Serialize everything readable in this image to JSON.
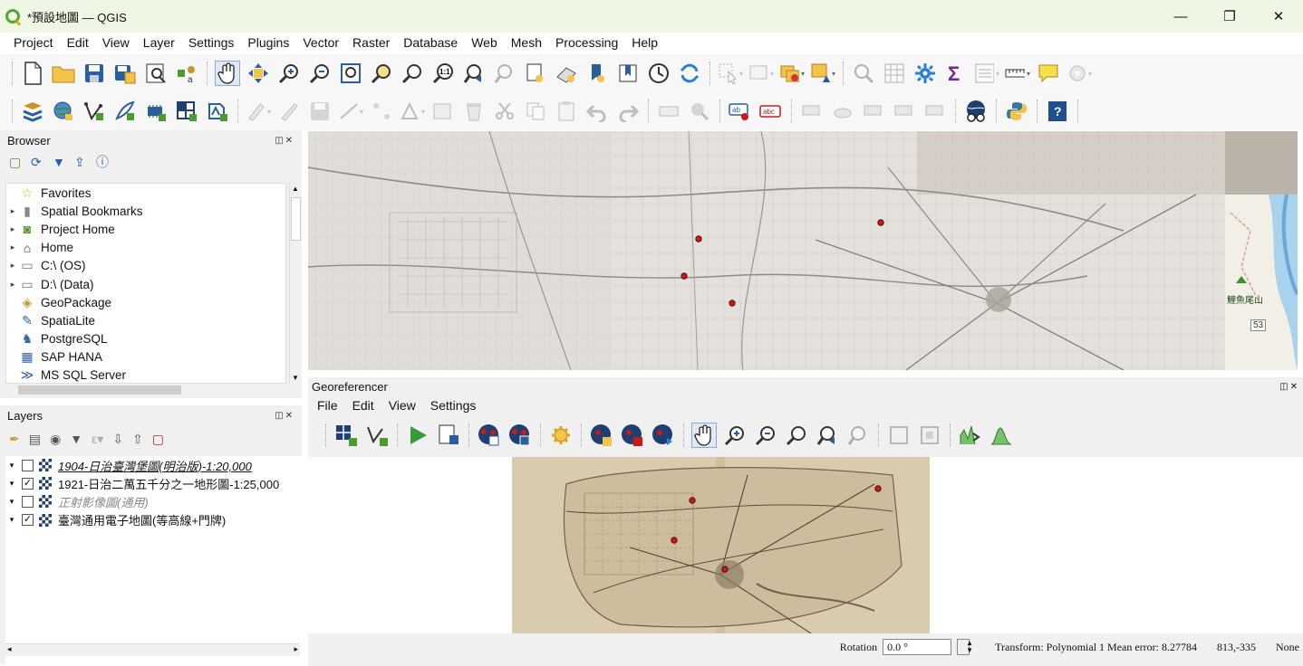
{
  "window": {
    "title": "*預設地圖 — QGIS",
    "controls": {
      "minimize": "—",
      "maximize": "❐",
      "close": "✕"
    }
  },
  "menubar": [
    "Project",
    "Edit",
    "View",
    "Layer",
    "Settings",
    "Plugins",
    "Vector",
    "Raster",
    "Database",
    "Web",
    "Mesh",
    "Processing",
    "Help"
  ],
  "browser": {
    "title": "Browser",
    "items": [
      {
        "label": "Favorites",
        "icon": "star-icon",
        "glyph": "☆",
        "color": "#e3b100",
        "arrow": ""
      },
      {
        "label": "Spatial Bookmarks",
        "icon": "bookmark-icon",
        "glyph": "▮",
        "color": "#888888",
        "arrow": "▸"
      },
      {
        "label": "Project Home",
        "icon": "project-home-icon",
        "glyph": "◙",
        "color": "#4b9b2f",
        "arrow": "▸"
      },
      {
        "label": "Home",
        "icon": "home-icon",
        "glyph": "⌂",
        "color": "#333333",
        "arrow": "▸"
      },
      {
        "label": "C:\\ (OS)",
        "icon": "folder-icon",
        "glyph": "▭",
        "color": "#777777",
        "arrow": "▸"
      },
      {
        "label": "D:\\ (Data)",
        "icon": "folder-icon",
        "glyph": "▭",
        "color": "#777777",
        "arrow": "▸"
      },
      {
        "label": "GeoPackage",
        "icon": "geopackage-icon",
        "glyph": "◈",
        "color": "#c6962a",
        "arrow": ""
      },
      {
        "label": "SpatiaLite",
        "icon": "spatialite-icon",
        "glyph": "✎",
        "color": "#2a5f9e",
        "arrow": ""
      },
      {
        "label": "PostgreSQL",
        "icon": "postgresql-icon",
        "glyph": "♞",
        "color": "#336791",
        "arrow": ""
      },
      {
        "label": "SAP HANA",
        "icon": "sap-hana-icon",
        "glyph": "▦",
        "color": "#2a5f9e",
        "arrow": ""
      },
      {
        "label": "MS SQL Server",
        "icon": "mssql-icon",
        "glyph": "≫",
        "color": "#2a5f9e",
        "arrow": ""
      }
    ]
  },
  "layers": {
    "title": "Layers",
    "items": [
      {
        "label": "1904-日治臺灣堡圖(明治版)-1:20,000",
        "checked": false,
        "style": "italic-underline"
      },
      {
        "label": "1921-日治二萬五千分之一地形圖-1:25,000",
        "checked": true,
        "style": "normal"
      },
      {
        "label": "正射影像圖(通用)",
        "checked": false,
        "style": "italic-gray"
      },
      {
        "label": "臺灣通用電子地圖(等高線+門牌)",
        "checked": true,
        "style": "normal"
      }
    ]
  },
  "map": {
    "labels": [
      "鯉魚尾山",
      "53"
    ]
  },
  "georeferencer": {
    "title": "Georeferencer",
    "menu": [
      "File",
      "Edit",
      "View",
      "Settings"
    ],
    "status": {
      "rotation_label": "Rotation",
      "rotation_value": "0.0 °",
      "transform": "Transform: Polynomial 1 Mean error: 8.27784",
      "coords": "813,-335",
      "crs": "None"
    }
  },
  "colors": {
    "marker": "#c61b1b",
    "titlebar": "#eef6e4",
    "accent": "#2a5f9e"
  }
}
